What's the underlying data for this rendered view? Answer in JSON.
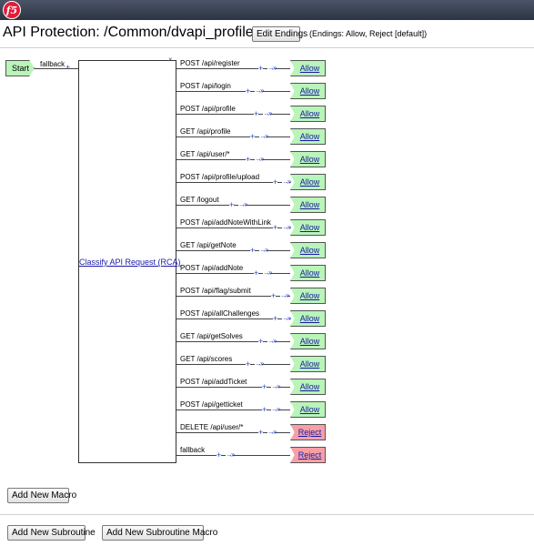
{
  "app": {
    "logo_text": "f5"
  },
  "header": {
    "title": "API Protection: /Common/dvapi_profile_prp",
    "edit_endings_label": "Edit Endings",
    "endings_info": "(Endings: Allow, Reject [default])"
  },
  "flow": {
    "start_label": "Start",
    "start_branch_label": "fallback",
    "rca_label": "Classify API Request (RCA)",
    "close_glyph": "×",
    "plus_glyph": "+",
    "arrow_glyph": "→»",
    "branches": [
      {
        "label": "POST /api/register",
        "ending": "Allow",
        "kind": "allow"
      },
      {
        "label": "POST /api/login",
        "ending": "Allow",
        "kind": "allow"
      },
      {
        "label": "POST /api/profile",
        "ending": "Allow",
        "kind": "allow"
      },
      {
        "label": "GET /api/profile",
        "ending": "Allow",
        "kind": "allow"
      },
      {
        "label": "GET /api/user/*",
        "ending": "Allow",
        "kind": "allow"
      },
      {
        "label": "POST /api/profile/upload",
        "ending": "Allow",
        "kind": "allow"
      },
      {
        "label": "GET /logout",
        "ending": "Allow",
        "kind": "allow"
      },
      {
        "label": "POST /api/addNoteWithLink",
        "ending": "Allow",
        "kind": "allow"
      },
      {
        "label": "GET /api/getNote",
        "ending": "Allow",
        "kind": "allow"
      },
      {
        "label": "POST /api/addNote",
        "ending": "Allow",
        "kind": "allow"
      },
      {
        "label": "POST /api/flag/submit",
        "ending": "Allow",
        "kind": "allow"
      },
      {
        "label": "POST /api/allChallenges",
        "ending": "Allow",
        "kind": "allow"
      },
      {
        "label": "GET /api/getSolves",
        "ending": "Allow",
        "kind": "allow"
      },
      {
        "label": "GET /api/scores",
        "ending": "Allow",
        "kind": "allow"
      },
      {
        "label": "POST /api/addTicket",
        "ending": "Allow",
        "kind": "allow"
      },
      {
        "label": "POST /api/getticket",
        "ending": "Allow",
        "kind": "allow"
      },
      {
        "label": "DELETE /api/user/*",
        "ending": "Reject",
        "kind": "reject"
      },
      {
        "label": "fallback",
        "ending": "Reject",
        "kind": "reject"
      }
    ]
  },
  "actions": {
    "add_macro_label": "Add New Macro",
    "add_subroutine_label": "Add New Subroutine",
    "add_subroutine_macro_label": "Add New Subroutine Macro"
  }
}
